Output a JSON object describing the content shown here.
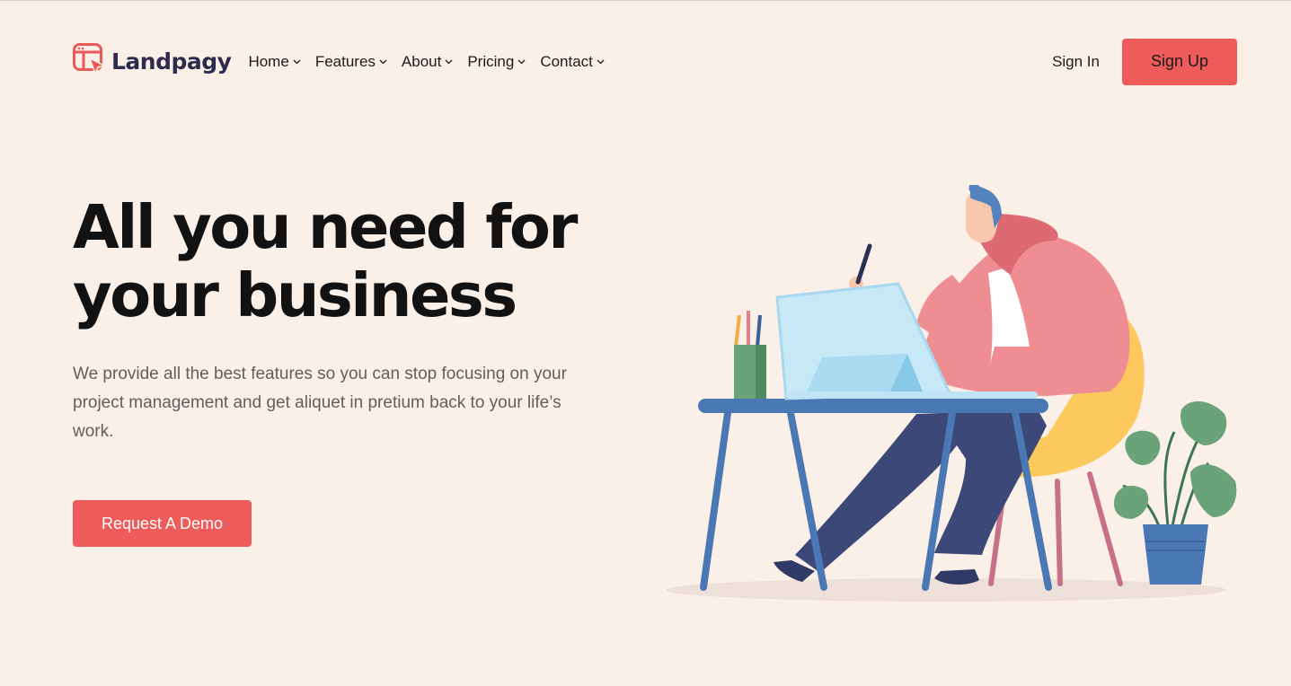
{
  "header": {
    "brand": "Landpagy",
    "nav": [
      {
        "label": "Home"
      },
      {
        "label": "Features"
      },
      {
        "label": "About"
      },
      {
        "label": "Pricing"
      },
      {
        "label": "Contact"
      }
    ],
    "sign_in": "Sign In",
    "sign_up": "Sign Up"
  },
  "hero": {
    "title_line1": "All you need for",
    "title_line2": "your business",
    "subtitle": "We provide all the best features so you can stop focusing on your project management and get aliquet in pretium back to your life’s work.",
    "cta": "Request A Demo"
  },
  "colors": {
    "background": "#fbf0e8",
    "accent": "#ed5b5b",
    "brand_text": "#2e2c4e"
  },
  "icons": {
    "logo": "browser-cursor-icon",
    "nav_dropdown": "chevron-down-icon"
  }
}
